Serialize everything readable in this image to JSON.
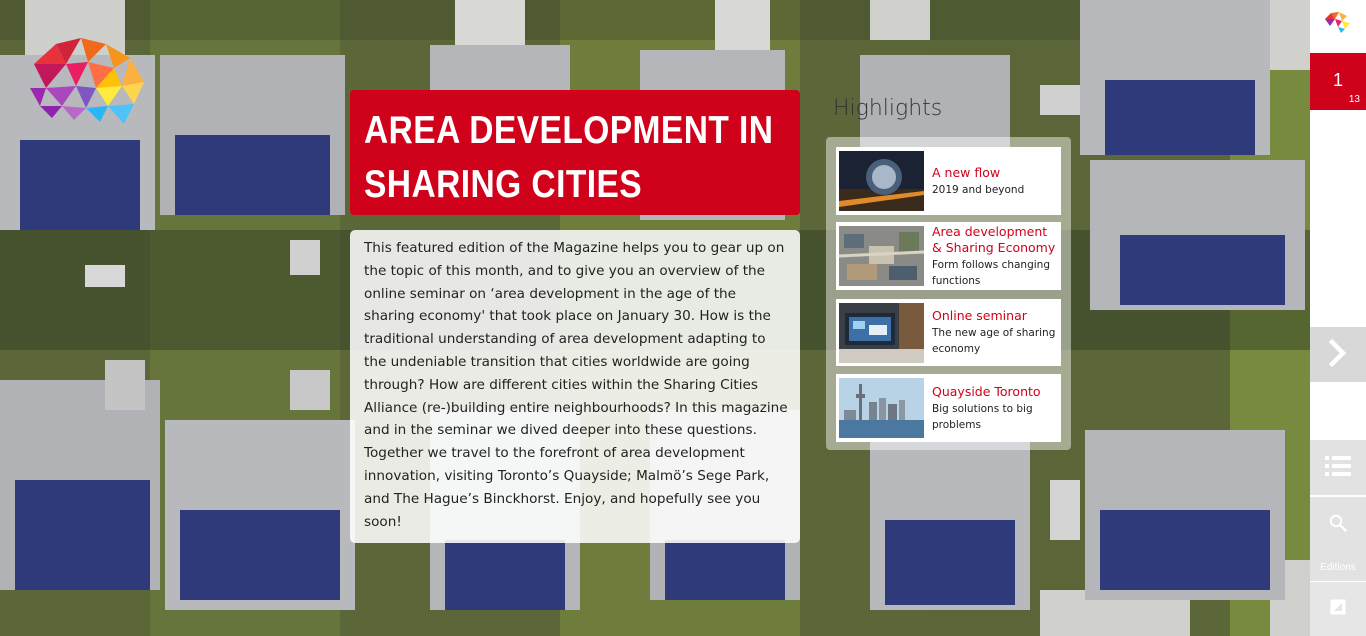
{
  "title": "AREA DEVELOPMENT IN SHARING CITIES",
  "intro": "This featured edition of the Magazine helps you to gear up on the topic of this month, and to give you an overview of the online seminar on ‘area development in the age of the sharing economy' that took place on January 30. How is the traditional understanding of area development adapting to the undeniable transition that cities worldwide are going through? How are different cities within the Sharing Cities Alliance (re-)building entire neighbourhoods? In this magazine and in the seminar we dived deeper into these questions. Together we travel to the forefront of area development innovation, visiting Toronto’s Quayside; Malmö’s Sege Park, and The Hague’s Binckhorst. Enjoy, and hopefully see you soon!",
  "highlights": {
    "heading": "Highlights",
    "items": [
      {
        "title": "A new flow",
        "subtitle": "2019 and beyond"
      },
      {
        "title": "Area development & Sharing Economy",
        "subtitle": "Form follows changing functions"
      },
      {
        "title": "Online seminar",
        "subtitle": "The new age of sharing economy"
      },
      {
        "title": "Quayside Toronto",
        "subtitle": "Big solutions to big problems"
      }
    ]
  },
  "sidebar": {
    "page_current": "1",
    "page_total": "13",
    "editions_label": "Editions",
    "icons": {
      "next": "chevron-right-icon",
      "toc": "list-icon",
      "search": "search-icon",
      "expand": "expand-icon"
    }
  },
  "colors": {
    "accent": "#d0021b",
    "sidebar_button": "#e2e2e2",
    "roof": "#2f3a7a",
    "lawn": "#6b7a3a"
  }
}
